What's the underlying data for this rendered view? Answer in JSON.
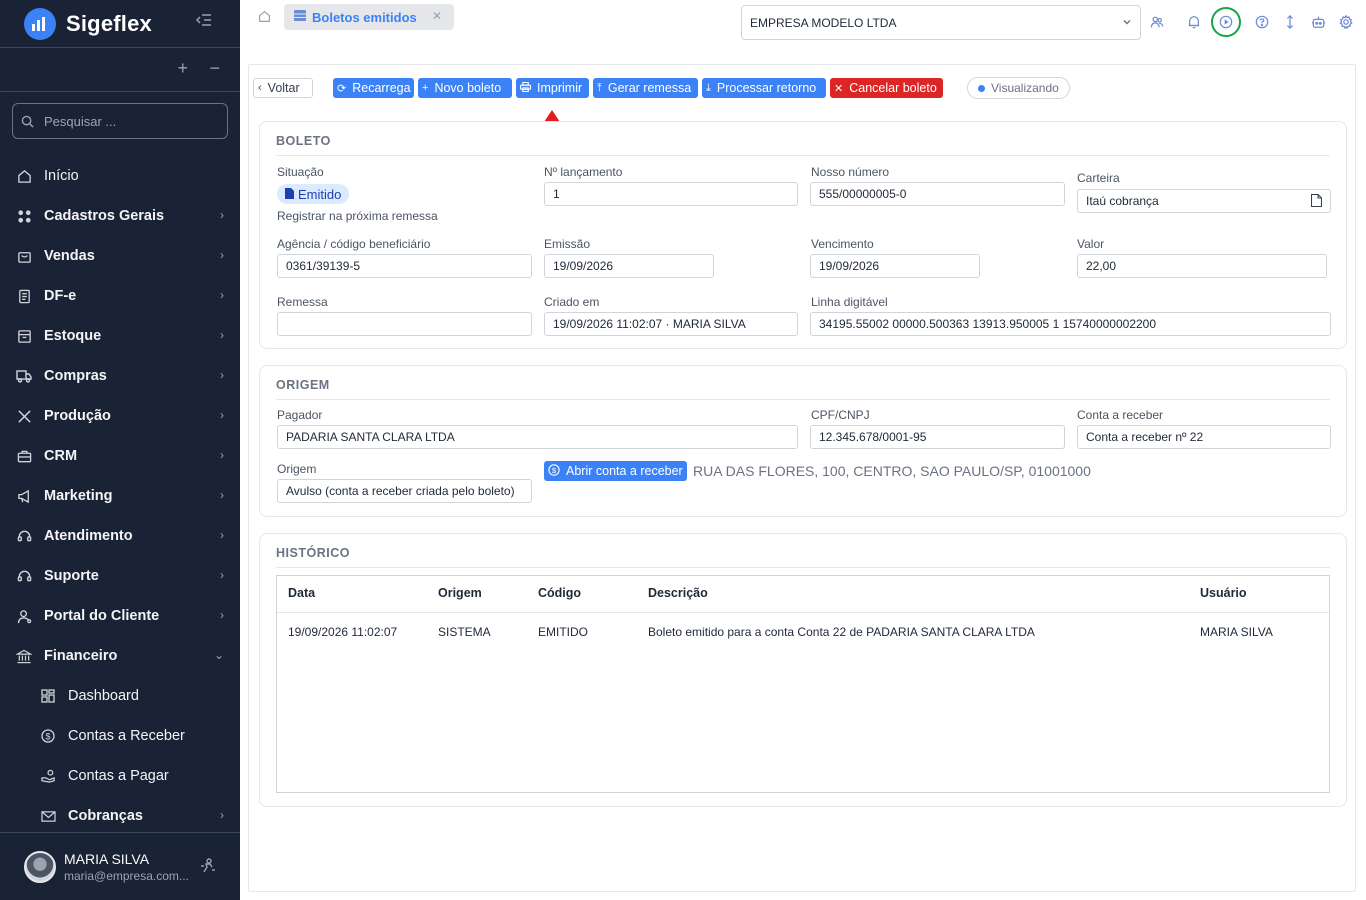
{
  "app": {
    "name": "Sigeflex"
  },
  "sidebar": {
    "search_placeholder": "Pesquisar ...",
    "items": [
      {
        "label": "Início",
        "icon": "home-icon"
      },
      {
        "label": "Cadastros Gerais",
        "icon": "grid-icon"
      },
      {
        "label": "Vendas",
        "icon": "shopping-bag-icon"
      },
      {
        "label": "DF-e",
        "icon": "document-icon"
      },
      {
        "label": "Estoque",
        "icon": "box-icon"
      },
      {
        "label": "Compras",
        "icon": "truck-icon"
      },
      {
        "label": "Produção",
        "icon": "tools-icon"
      },
      {
        "label": "CRM",
        "icon": "briefcase-icon"
      },
      {
        "label": "Marketing",
        "icon": "megaphone-icon"
      },
      {
        "label": "Atendimento",
        "icon": "headset-icon"
      },
      {
        "label": "Suporte",
        "icon": "headset-icon"
      },
      {
        "label": "Portal do Cliente",
        "icon": "user-icon"
      },
      {
        "label": "Financeiro",
        "icon": "bank-icon"
      }
    ],
    "sub_items": [
      {
        "label": "Dashboard",
        "icon": "dashboard-icon"
      },
      {
        "label": "Contas a Receber",
        "icon": "dollar-circle-icon"
      },
      {
        "label": "Contas a Pagar",
        "icon": "hand-coins-icon"
      },
      {
        "label": "Cobranças",
        "icon": "mail-icon"
      }
    ],
    "user": {
      "name": "MARIA SILVA",
      "email": "maria@empresa.com..."
    }
  },
  "topbar": {
    "tab_label": "Boletos emitidos",
    "company": "EMPRESA MODELO LTDA"
  },
  "toolbar": {
    "back": "Voltar",
    "reload": "Recarrega",
    "new": "Novo boleto",
    "print": "Imprimir",
    "remessa": "Gerar remessa",
    "retorno": "Processar retorno",
    "cancel": "Cancelar boleto",
    "status": "Visualizando"
  },
  "boleto": {
    "title": "BOLETO",
    "situacao_label": "Situação",
    "situacao_value": "Emitido",
    "situacao_hint": "Registrar na próxima remessa",
    "lancamento_label": "Nº lançamento",
    "lancamento_value": "1",
    "nosso_numero_label": "Nosso número",
    "nosso_numero_value": "555/00000005-0",
    "carteira_label": "Carteira",
    "carteira_value": "Itaú cobrança",
    "agencia_label": "Agência / código beneficiário",
    "agencia_value": "0361/39139-5",
    "emissao_label": "Emissão",
    "emissao_value": "19/09/2026",
    "vencimento_label": "Vencimento",
    "vencimento_value": "19/09/2026",
    "valor_label": "Valor",
    "valor_value": "22,00",
    "remessa_label": "Remessa",
    "remessa_value": "",
    "criado_label": "Criado em",
    "criado_value": "19/09/2026 11:02:07 · MARIA SILVA",
    "linha_label": "Linha digitável",
    "linha_value": "34195.55002 00000.500363 13913.950005 1 15740000002200"
  },
  "origem": {
    "title": "ORIGEM",
    "pagador_label": "Pagador",
    "pagador_value": "PADARIA SANTA CLARA LTDA",
    "cpf_label": "CPF/CNPJ",
    "cpf_value": "12.345.678/0001-95",
    "conta_label": "Conta a receber",
    "conta_value": "Conta a receber nº 22",
    "origem_label": "Origem",
    "origem_value": "Avulso (conta a receber criada pelo boleto)",
    "open_button": "Abrir conta a receber",
    "address": "RUA DAS FLORES, 100, CENTRO, SAO PAULO/SP, 01001000"
  },
  "historico": {
    "title": "HISTÓRICO",
    "columns": [
      "Data",
      "Origem",
      "Código",
      "Descrição",
      "Usuário"
    ],
    "rows": [
      [
        "19/09/2026 11:02:07",
        "SISTEMA",
        "EMITIDO",
        "Boleto emitido para a conta Conta 22 de PADARIA SANTA CLARA LTDA",
        "MARIA SILVA"
      ]
    ]
  },
  "colors": {
    "sidebar_bg": "#1a2235",
    "primary": "#3b82f6",
    "danger": "#dc2626",
    "highlight_ring": "#16a34a",
    "annotation_arrow": "#e11d1d"
  }
}
